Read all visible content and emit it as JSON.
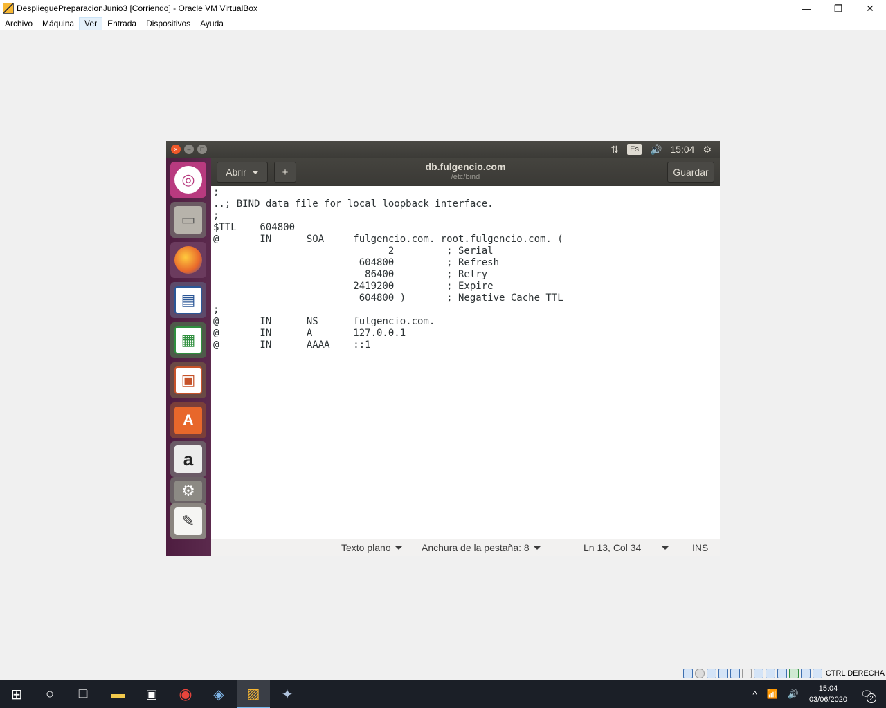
{
  "host_window": {
    "title": "DesplieguePreparacionJunio3 [Corriendo] - Oracle VM VirtualBox",
    "controls": {
      "minimize": "—",
      "restore": "❐",
      "close": "✕"
    },
    "menu": [
      "Archivo",
      "Máquina",
      "Ver",
      "Entrada",
      "Dispositivos",
      "Ayuda"
    ]
  },
  "guest_topbar": {
    "indicators": {
      "network": "⇅",
      "keyboard": "Es",
      "volume": "🔊",
      "time": "15:04",
      "settings": "⚙"
    }
  },
  "launcher": {
    "items": [
      {
        "name": "ubuntu-dash",
        "glyph": "◎",
        "color": "#d0458f"
      },
      {
        "name": "files",
        "glyph": "▭",
        "color": "#8c8a84"
      },
      {
        "name": "firefox",
        "glyph": "●",
        "color": "#e8672b"
      },
      {
        "name": "writer",
        "glyph": "▤",
        "color": "#2b5797"
      },
      {
        "name": "calc",
        "glyph": "▦",
        "color": "#2f8f3e"
      },
      {
        "name": "impress",
        "glyph": "▣",
        "color": "#c6532a"
      },
      {
        "name": "software-center",
        "glyph": "A",
        "color": "#e8672b"
      },
      {
        "name": "amazon",
        "glyph": "a",
        "color": "#6d6d6d"
      },
      {
        "name": "system-settings",
        "glyph": "⚙",
        "color": "#6d6d6d"
      },
      {
        "name": "text-editor",
        "glyph": "✎",
        "color": "#c9c6bf"
      }
    ]
  },
  "gedit": {
    "open_label": "Abrir",
    "new_tab_icon": "+",
    "file_name": "db.fulgencio.com",
    "file_path": "/etc/bind",
    "save_label": "Guardar",
    "lines": [
      ";",
      "..; BIND data file for local loopback interface.",
      ";",
      "$TTL    604800",
      "@       IN      SOA     fulgencio.com. root.fulgencio.com. (",
      "                              2         ; Serial",
      "                         604800         ; Refresh",
      "                          86400         ; Retry",
      "                        2419200         ; Expire",
      "                         604800 )       ; Negative Cache TTL",
      ";",
      "@       IN      NS      fulgencio.com.",
      "@       IN      A       127.0.0.1",
      "@       IN      AAAA    ::1"
    ],
    "status": {
      "language": "Texto plano",
      "tab_width": "Anchura de la pestaña: 8",
      "position": "Ln 13, Col 34",
      "mode": "INS"
    }
  },
  "vb_status": {
    "host_key": "CTRL DERECHA",
    "icon_count": 12
  },
  "taskbar": {
    "items": [
      {
        "name": "start",
        "glyph": "⊞"
      },
      {
        "name": "search",
        "glyph": "○"
      },
      {
        "name": "task-view",
        "glyph": "❑"
      },
      {
        "name": "file-explorer",
        "glyph": "▬"
      },
      {
        "name": "store",
        "glyph": "▣"
      },
      {
        "name": "chrome",
        "glyph": "◉"
      },
      {
        "name": "virtualbox-cube",
        "glyph": "◈"
      },
      {
        "name": "virtualbox-vm",
        "glyph": "▨"
      },
      {
        "name": "virtualbox-app",
        "glyph": "✦"
      }
    ],
    "tray": {
      "chevron": "^",
      "wifi": "📶",
      "volume": "🔊",
      "time": "15:04",
      "date": "03/06/2020",
      "notifications": "🗨",
      "notification_count": "2"
    }
  }
}
